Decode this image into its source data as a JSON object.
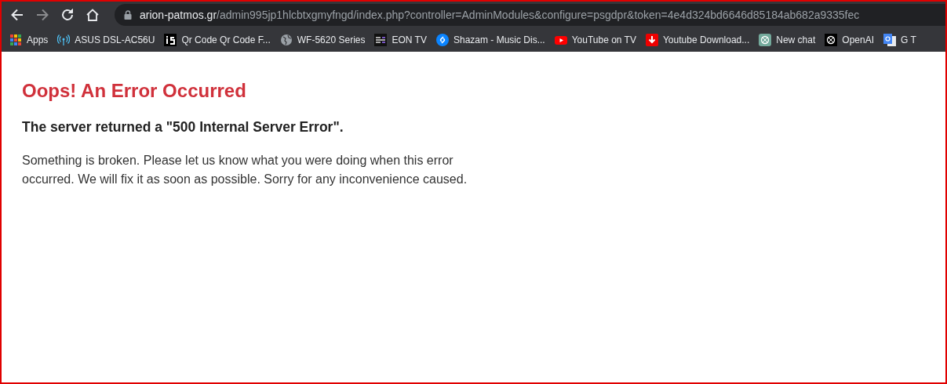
{
  "browser": {
    "url_host": "arion-patmos.gr",
    "url_path": "/admin995jp1hlcbtxgmyfngd/index.php?controller=AdminModules&configure=psgdpr&token=4e4d324bd6646d85184ab682a9335fec",
    "forward_disabled": true,
    "bookmarks": [
      {
        "label": "Apps",
        "kind": "apps"
      },
      {
        "label": "ASUS DSL-AC56U",
        "kind": "antenna"
      },
      {
        "label": "Qr Code Qr Code F...",
        "kind": "square-logo"
      },
      {
        "label": "WF-5620 Series",
        "kind": "globe"
      },
      {
        "label": "EON TV",
        "kind": "lines"
      },
      {
        "label": "Shazam - Music Dis...",
        "kind": "shazam"
      },
      {
        "label": "YouTube on TV",
        "kind": "play"
      },
      {
        "label": "Youtube Download...",
        "kind": "download"
      },
      {
        "label": "New chat",
        "kind": "knot-light"
      },
      {
        "label": "OpenAI",
        "kind": "knot-dark"
      },
      {
        "label": "G T",
        "kind": "translate"
      }
    ]
  },
  "page": {
    "title": "Oops! An Error Occurred",
    "subtitle": "The server returned a \"500 Internal Server Error\".",
    "message": "Something is broken. Please let us know what you were doing when this error occurred. We will fix it as soon as possible. Sorry for any inconvenience caused."
  }
}
